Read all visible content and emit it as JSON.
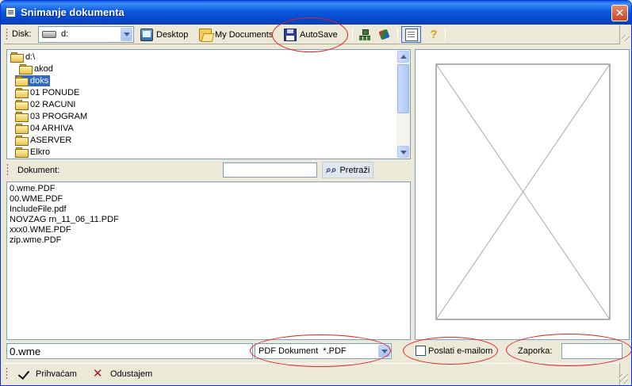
{
  "window": {
    "title": "Snimanje dokumenta"
  },
  "toolbar": {
    "disk_label": "Disk:",
    "disk_value": "d:",
    "desktop_label": "Desktop",
    "mydocs_label": "My Documents",
    "autosave_label": "AutoSave",
    "help_glyph": "?"
  },
  "tree": {
    "items": [
      {
        "label": "d:\\",
        "selected": false
      },
      {
        "label": "akod",
        "selected": false
      },
      {
        "label": "doks",
        "selected": true
      },
      {
        "label": "01 PONUDE",
        "selected": false
      },
      {
        "label": "02 RACUNI",
        "selected": false
      },
      {
        "label": "03 PROGRAM",
        "selected": false
      },
      {
        "label": "04 ARHIVA",
        "selected": false
      },
      {
        "label": "ASERVER",
        "selected": false
      },
      {
        "label": "Elkro",
        "selected": false
      }
    ]
  },
  "search": {
    "label": "Dokument:",
    "value": "",
    "button_label": "Pretraži"
  },
  "files": {
    "items": [
      "0.wme.PDF",
      "00.WME.PDF",
      "IncludeFile.pdf",
      "NOVZAG rn_11_06_11.PDF",
      "xxx0.WME.PDF",
      "zip.wme.PDF"
    ]
  },
  "bottom": {
    "filename_value": "0.wme",
    "filetype_value": "PDF Dokument  *.PDF",
    "email_label": "Poslati e-mailom",
    "email_checked": false,
    "password_label": "Zaporka:",
    "password_value": ""
  },
  "actions": {
    "accept_label": "Prihvaćam",
    "cancel_label": "Odustajem"
  },
  "colors": {
    "titlebar": "#0b58de",
    "selection": "#316ac5",
    "annotation": "#e02020"
  }
}
